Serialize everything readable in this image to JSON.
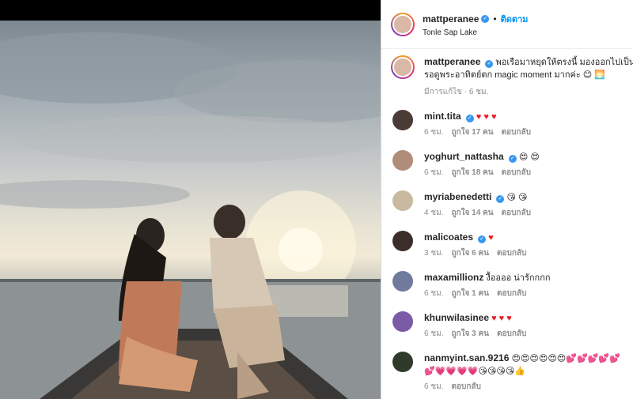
{
  "post": {
    "username": "mattperanee",
    "follow_label": "ติดตาม",
    "location": "Tonle Sap Lake",
    "caption_line1": "พอเรือมาหยุดให้ตรงนี้ มองออกไปเป็นเส้นข",
    "caption_line2": "รอดูพระอาทิตย์ตก magic moment มากค่ะ 😊 🌅",
    "caption_meta": "มีการแก้ไข · 6 ชม."
  },
  "comments": [
    {
      "user": "mint.tita",
      "verified": true,
      "text": "♥ ♥ ♥",
      "time": "6 ชม.",
      "likes": "ถูกใจ 17 คน",
      "reply": "ตอบกลับ",
      "avatar_color": "#4a3b35"
    },
    {
      "user": "yoghurt_nattasha",
      "verified": true,
      "text": "😍 😍",
      "time": "6 ชม.",
      "likes": "ถูกใจ 18 คน",
      "reply": "ตอบกลับ",
      "avatar_color": "#b08c7a"
    },
    {
      "user": "myriabenedetti",
      "verified": true,
      "text": "😘 😘",
      "time": "4 ชม.",
      "likes": "ถูกใจ 14 คน",
      "reply": "ตอบกลับ",
      "avatar_color": "#c8b9a0"
    },
    {
      "user": "malicoates",
      "verified": true,
      "text": "♥",
      "time": "3 ชม.",
      "likes": "ถูกใจ 6 คน",
      "reply": "ตอบกลับ",
      "avatar_color": "#3b2e2a"
    },
    {
      "user": "maxamillionz",
      "verified": false,
      "text": "งื้ออออ น่ารักกกก",
      "time": "6 ชม.",
      "likes": "ถูกใจ 1 คน",
      "reply": "ตอบกลับ",
      "avatar_color": "#6f7a9c"
    },
    {
      "user": "khunwilasinee",
      "verified": false,
      "text": "♥ ♥ ♥",
      "time": "6 ชม.",
      "likes": "ถูกใจ 3 คน",
      "reply": "ตอบกลับ",
      "avatar_color": "#7b5aa6"
    },
    {
      "user": "nanmyint.san.9216",
      "verified": false,
      "text": "😍😍😍😍😍😍💕💕💕💕💕",
      "text2": "💕💗💗💗💗😘😘😘😘👍",
      "time": "6 ชม.",
      "likes": "",
      "reply": "ตอบกลับ",
      "avatar_color": "#2f3a2a"
    }
  ]
}
